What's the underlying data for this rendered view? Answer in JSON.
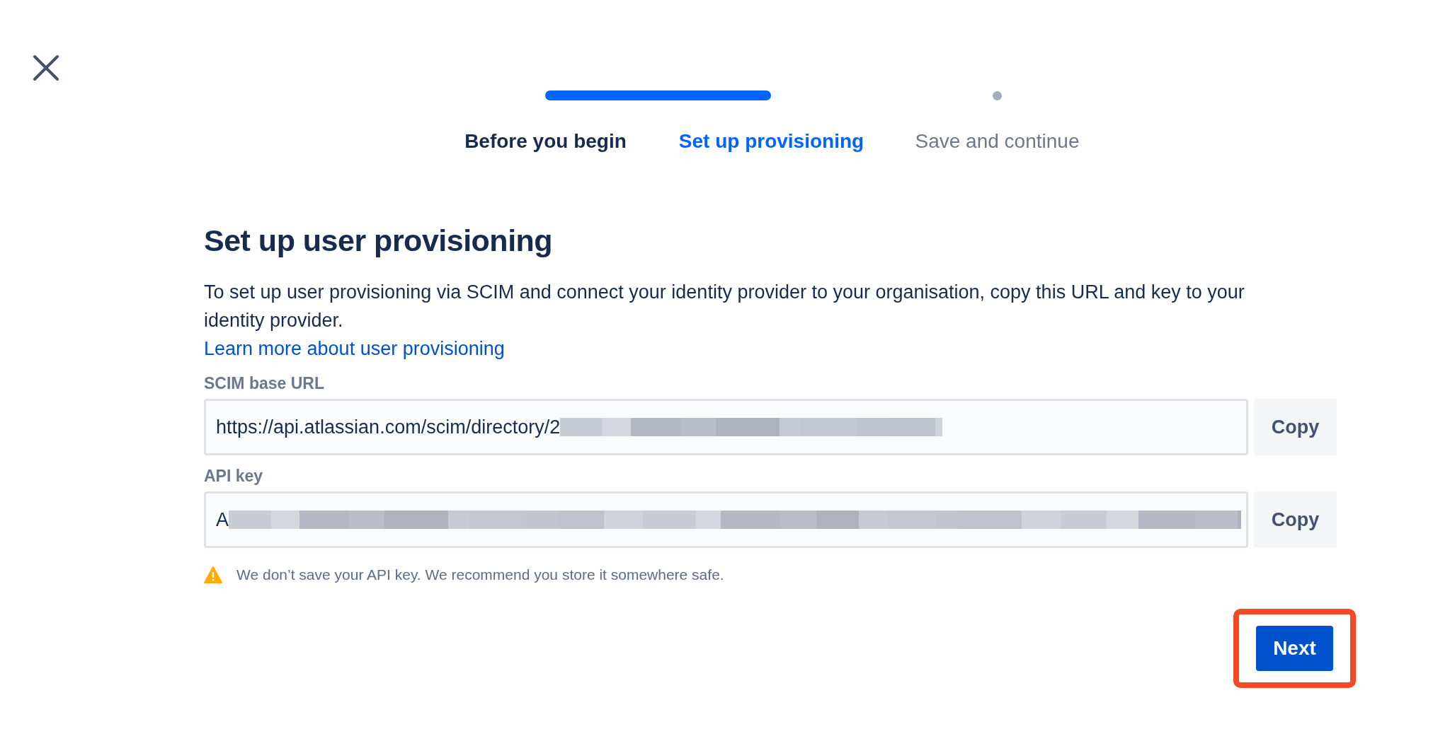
{
  "steps": [
    {
      "label": "Before you begin",
      "done": true,
      "selected": false
    },
    {
      "label": "Set up provisioning",
      "done": false,
      "selected": true
    },
    {
      "label": "Save and continue",
      "done": false,
      "selected": false
    }
  ],
  "heading": "Set up user provisioning",
  "description": "To set up user provisioning via SCIM and connect your identity provider to your organisation, copy this URL and key to your identity provider.",
  "link": "Learn more about user provisioning",
  "fields": [
    {
      "label": "SCIM base URL",
      "value": "https://api.atlassian.com/scim/directory/2",
      "redacted": true,
      "button": "Copy"
    },
    {
      "label": "API key",
      "value": "A",
      "redacted": true,
      "button": "Copy"
    }
  ],
  "warning": "We don’t save your API key. We recommend you store it somewhere safe.",
  "next_button": {
    "label": "Next",
    "highlighted": true
  }
}
